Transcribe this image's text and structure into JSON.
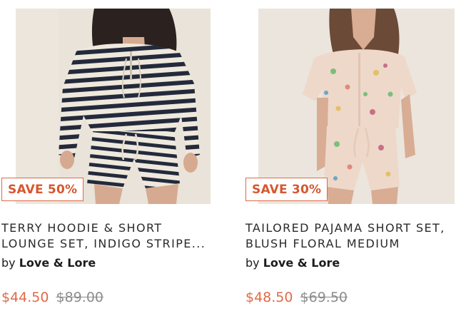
{
  "products": [
    {
      "badge": "SAVE 50%",
      "title_line1": "TERRY HOODIE & SHORT",
      "title_line2": "LOUNGE SET, INDIGO STRIPE...",
      "by": "by",
      "brand": "Love & Lore",
      "sale_price": "$44.50",
      "original_price": "$89.00"
    },
    {
      "badge": "SAVE 30%",
      "title_line1": "TAILORED PAJAMA SHORT SET,",
      "title_line2": "BLUSH FLORAL MEDIUM",
      "by": "by",
      "brand": "Love & Lore",
      "sale_price": "$48.50",
      "original_price": "$69.50"
    }
  ],
  "colors": {
    "accent": "#e06a47",
    "strike": "#8c8c8c",
    "text": "#2a2a2a"
  }
}
